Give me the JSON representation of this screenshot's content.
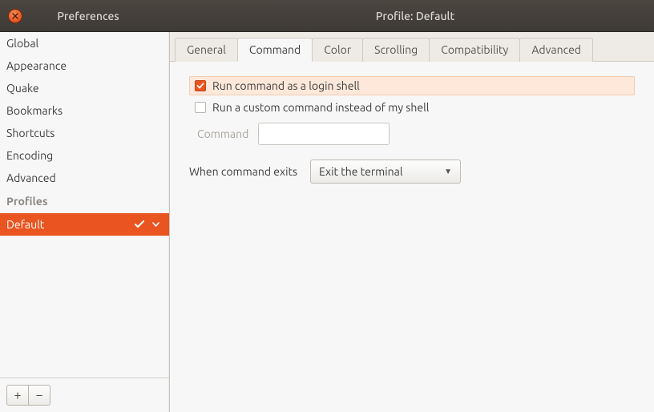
{
  "window": {
    "sidebar_title": "Preferences",
    "main_title": "Profile: Default"
  },
  "sidebar": {
    "items": [
      "Global",
      "Appearance",
      "Quake",
      "Bookmarks",
      "Shortcuts",
      "Encoding",
      "Advanced"
    ],
    "profiles_header": "Profiles",
    "profiles": [
      "Default"
    ],
    "active_profile": "Default",
    "add_label": "+",
    "remove_label": "−"
  },
  "tabs": {
    "items": [
      "General",
      "Command",
      "Color",
      "Scrolling",
      "Compatibility",
      "Advanced"
    ],
    "active": "Command"
  },
  "command_panel": {
    "login_shell": {
      "checked": true,
      "label": "Run command as a login shell"
    },
    "custom_command": {
      "checked": false,
      "label": "Run a custom command instead of my shell"
    },
    "command_label": "Command",
    "command_value": "",
    "exit_label": "When command exits",
    "exit_value": "Exit the terminal"
  }
}
